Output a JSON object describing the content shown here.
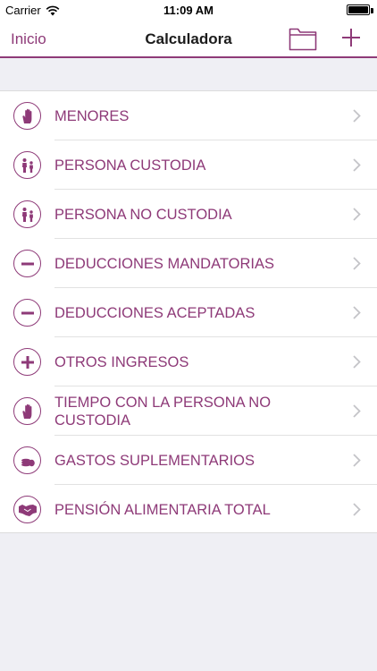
{
  "status": {
    "carrier": "Carrier",
    "time": "11:09 AM"
  },
  "nav": {
    "back_label": "Inicio",
    "title": "Calculadora"
  },
  "colors": {
    "accent": "#8e3a78",
    "background": "#efeff4"
  },
  "items": [
    {
      "label": "MENORES",
      "icon": "hand-icon"
    },
    {
      "label": "PERSONA CUSTODIA",
      "icon": "parent-child-icon"
    },
    {
      "label": "PERSONA NO CUSTODIA",
      "icon": "parent-child-icon"
    },
    {
      "label": "DEDUCCIONES MANDATORIAS",
      "icon": "minus-icon"
    },
    {
      "label": "DEDUCCIONES ACEPTADAS",
      "icon": "minus-icon"
    },
    {
      "label": "OTROS INGRESOS",
      "icon": "plus-icon"
    },
    {
      "label": "TIEMPO CON LA PERSONA NO CUSTODIA",
      "icon": "hand-icon"
    },
    {
      "label": "GASTOS SUPLEMENTARIOS",
      "icon": "coins-icon"
    },
    {
      "label": "PENSIÓN ALIMENTARIA TOTAL",
      "icon": "handshake-icon"
    }
  ]
}
